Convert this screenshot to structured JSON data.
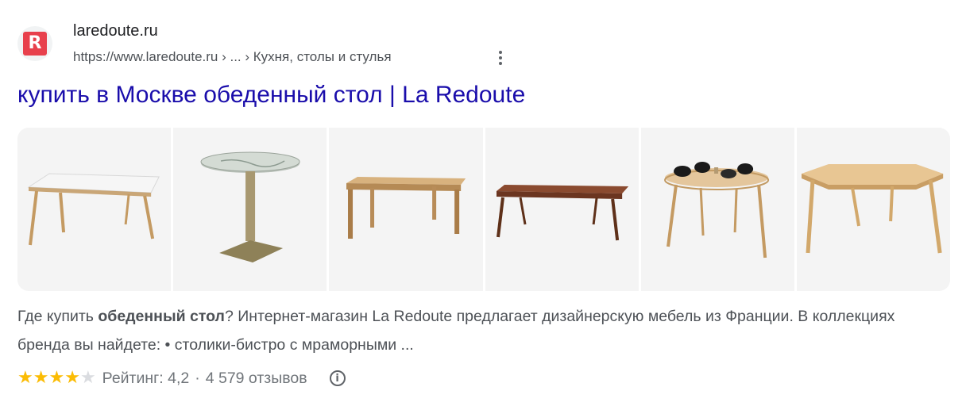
{
  "result": {
    "favicon_letter": "R",
    "favicon_color": "#e8404c",
    "site_name": "laredoute.ru",
    "breadcrumb": "https://www.laredoute.ru › ... › Кухня, столы и стулья",
    "more_icon": "three-dots-vertical-icon",
    "title": "купить в Москве обеденный стол | La Redoute",
    "title_color": "#1a0dab",
    "images": [
      {
        "name": "white-top-oak-leg-table-image"
      },
      {
        "name": "marble-bistro-table-image"
      },
      {
        "name": "oak-rectangular-table-image"
      },
      {
        "name": "walnut-long-table-image"
      },
      {
        "name": "round-table-with-bowls-image"
      },
      {
        "name": "oak-hexagonal-table-image"
      }
    ],
    "snippet": {
      "part1": "Где купить ",
      "bold": "обеденный стол",
      "part2": "? Интернет-магазин La Redoute предлагает дизайнерскую мебель из Франции. В коллекциях бренда вы найдете: • столики-бистро с мраморными ..."
    },
    "rating": {
      "stars_filled": 4,
      "stars_total": 5,
      "star_color": "#fbbc04",
      "label": "Рейтинг: 4,2",
      "separator": "·",
      "reviews": "4 579 отзывов",
      "info_icon": "info-icon"
    }
  }
}
